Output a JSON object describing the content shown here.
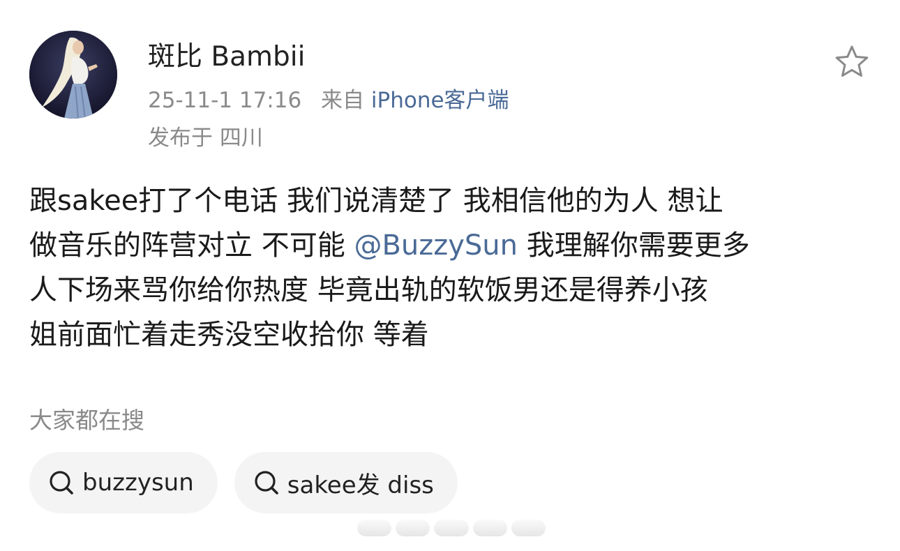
{
  "post": {
    "user": {
      "name": "斑比 Bambii",
      "avatar": "avatar-image"
    },
    "time": "25-11-1 17:16",
    "source_prefix": "来自",
    "source_device": "iPhone客户端",
    "location": "发布于 四川",
    "favorite_icon": "star-icon",
    "body": {
      "line1": "跟sakee打了个电话 我们说清楚了 我相信他的为人 想让",
      "line2_before": "做音乐的阵营对立 不可能 ",
      "mention": "@BuzzySun",
      "line2_after": " 我理解你需要更多",
      "line3": "人下场来骂你给你热度 毕竟出轨的软饭男还是得养小孩",
      "line4": "姐前面忙着走秀没空收拾你 等着"
    }
  },
  "hot_search": {
    "title": "大家都在搜",
    "items": [
      {
        "icon": "search-icon",
        "label": "buzzysun"
      },
      {
        "icon": "search-icon",
        "label": "sakee发 diss"
      }
    ]
  },
  "colors": {
    "link": "#4a6a96",
    "meta": "#8a8a8a",
    "text": "#1a1a1a",
    "chip_bg": "#f4f4f4"
  }
}
